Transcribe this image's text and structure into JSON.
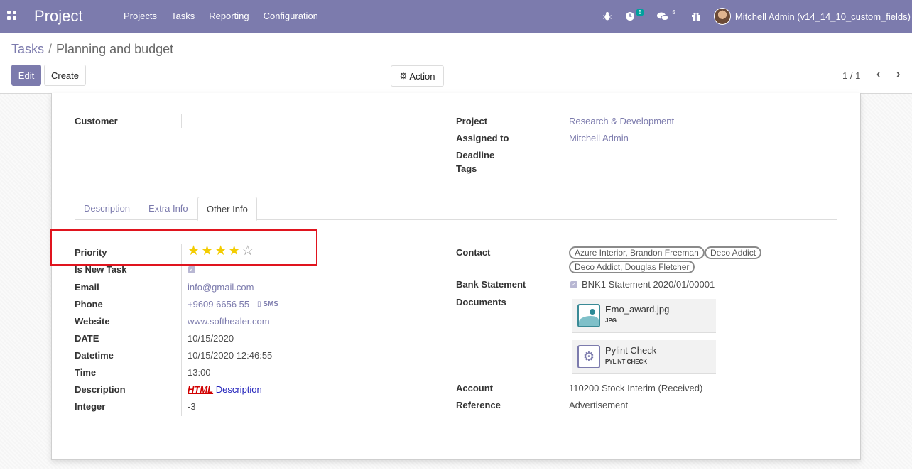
{
  "navbar": {
    "brand": "Project",
    "menu": [
      "Projects",
      "Tasks",
      "Reporting",
      "Configuration"
    ],
    "activity_count": "5",
    "messages_count": "5",
    "user_name": "Mitchell Admin (v14_14_10_custom_fields)"
  },
  "breadcrumb": {
    "parent": "Tasks",
    "separator": "/",
    "current": "Planning and budget"
  },
  "controls": {
    "edit_label": "Edit",
    "create_label": "Create",
    "action_label": "Action",
    "pager": "1 / 1"
  },
  "header_fields": {
    "customer_label": "Customer",
    "customer_value": "",
    "project_label": "Project",
    "project_value": "Research & Development",
    "assigned_label": "Assigned to",
    "assigned_value": "Mitchell Admin",
    "deadline_label": "Deadline",
    "tags_label": "Tags"
  },
  "tabs": [
    "Description",
    "Extra Info",
    "Other Info"
  ],
  "active_tab": "Other Info",
  "left_fields": {
    "priority_label": "Priority",
    "priority_value": 4,
    "priority_max": 5,
    "new_task_label": "Is New Task",
    "new_task_checked": true,
    "email_label": "Email",
    "email_value": "info@gmail.com",
    "phone_label": "Phone",
    "phone_value": "+9609 6656 55",
    "sms_label": "SMS",
    "website_label": "Website",
    "website_value": "www.softhealer.com",
    "date_label": "DATE",
    "date_value": "10/15/2020",
    "datetime_label": "Datetime",
    "datetime_value": "10/15/2020 12:46:55",
    "time_label": "Time",
    "time_value": "13:00",
    "description_label": "Description",
    "description_html": "HTML",
    "description_text": "Description",
    "integer_label": "Integer",
    "integer_value": "-3"
  },
  "right_fields": {
    "contact_label": "Contact",
    "contacts": [
      "Azure Interior, Brandon Freeman",
      "Deco Addict",
      "Deco Addict, Douglas Fletcher"
    ],
    "bank_label": "Bank Statement",
    "bank_value": "BNK1 Statement 2020/01/00001",
    "documents_label": "Documents",
    "documents": [
      {
        "name": "Emo_award.jpg",
        "ext": "JPG",
        "icon": "image-icon"
      },
      {
        "name": "Pylint Check",
        "ext": "PYLINT CHECK",
        "icon": "gear-icon"
      }
    ],
    "account_label": "Account",
    "account_value": "110200 Stock Interim (Received)",
    "reference_label": "Reference",
    "reference_value": "Advertisement"
  },
  "colors": {
    "brand": "#7c7bad",
    "star": "#f3cc00",
    "highlight": "#e0141e"
  }
}
